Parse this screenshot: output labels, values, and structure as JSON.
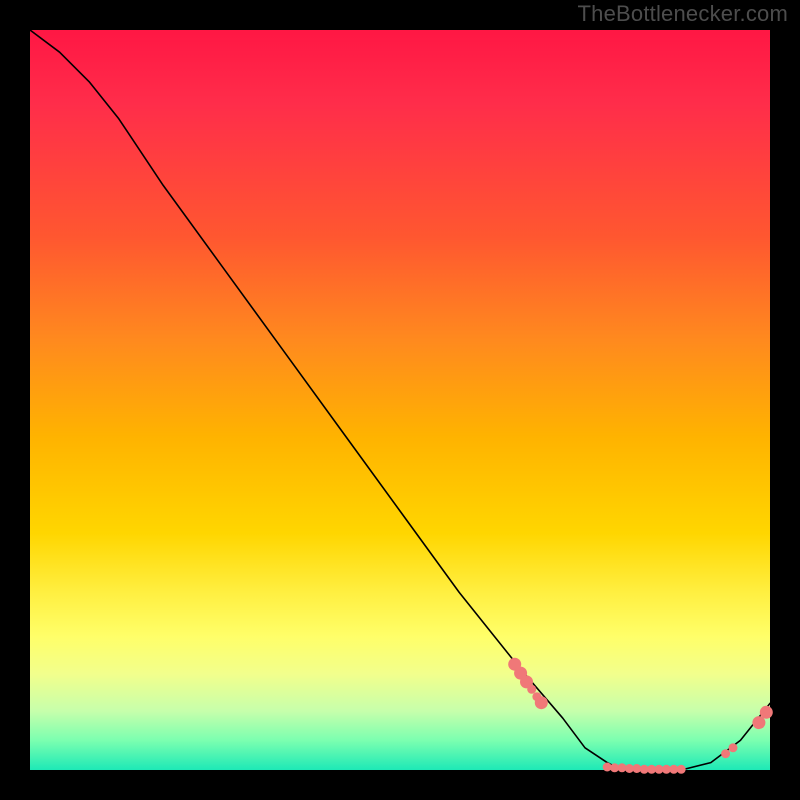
{
  "brand": "TheBottlenecker.com",
  "chart_data": {
    "type": "line",
    "title": "",
    "xlabel": "",
    "ylabel": "",
    "xlim": [
      0,
      100
    ],
    "ylim": [
      0,
      100
    ],
    "legend": false,
    "grid": false,
    "comment": "x is normalised hardware-match axis 0–100; y is bottleneck percentage 0–100 (lower is better).",
    "series": [
      {
        "name": "bottleneck-curve",
        "x": [
          0,
          4,
          8,
          12,
          18,
          26,
          34,
          42,
          50,
          58,
          66,
          72,
          75,
          78,
          80,
          82,
          85,
          88,
          92,
          96,
          100
        ],
        "y": [
          100,
          97,
          93,
          88,
          79,
          68,
          57,
          46,
          35,
          24,
          14,
          7,
          3,
          1,
          0,
          0,
          0,
          0,
          1,
          4,
          9
        ]
      }
    ],
    "markers": [
      {
        "x": 65.5,
        "y": 14.3
      },
      {
        "x": 66.3,
        "y": 13.1
      },
      {
        "x": 67.1,
        "y": 11.9
      },
      {
        "x": 67.8,
        "y": 10.9
      },
      {
        "x": 68.5,
        "y": 9.9
      },
      {
        "x": 69.1,
        "y": 9.1
      },
      {
        "x": 78.0,
        "y": 0.4
      },
      {
        "x": 79.0,
        "y": 0.3
      },
      {
        "x": 80.0,
        "y": 0.3
      },
      {
        "x": 81.0,
        "y": 0.2
      },
      {
        "x": 82.0,
        "y": 0.2
      },
      {
        "x": 83.0,
        "y": 0.1
      },
      {
        "x": 84.0,
        "y": 0.1
      },
      {
        "x": 85.0,
        "y": 0.1
      },
      {
        "x": 86.0,
        "y": 0.1
      },
      {
        "x": 87.0,
        "y": 0.1
      },
      {
        "x": 88.0,
        "y": 0.1
      },
      {
        "x": 94.0,
        "y": 2.2
      },
      {
        "x": 95.0,
        "y": 3.0
      },
      {
        "x": 98.5,
        "y": 6.4
      },
      {
        "x": 99.5,
        "y": 7.8
      }
    ],
    "marker_radius_large_at": [
      65.5,
      66.3,
      67.1,
      69.1,
      98.5,
      99.5
    ],
    "gradient_description": "vertical red→yellow→green, yitself encodes the severity band"
  }
}
